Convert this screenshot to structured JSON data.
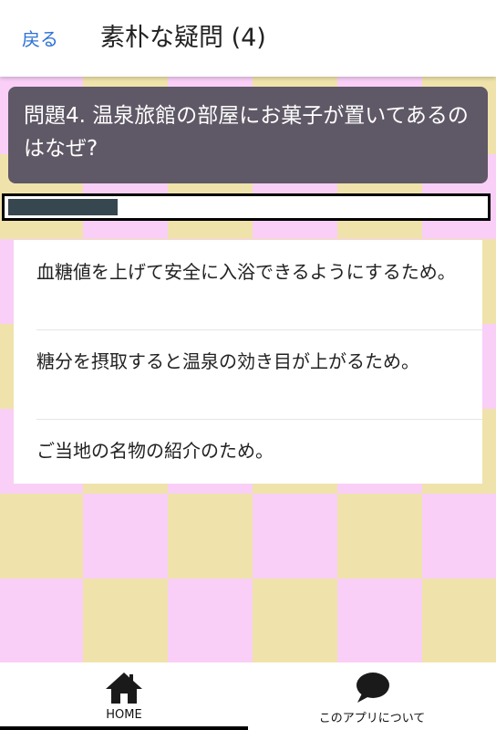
{
  "header": {
    "back_label": "戻る",
    "title": "素朴な疑問 (4)"
  },
  "question": {
    "text": "問題4. 温泉旅館の部屋にお菓子が置いてあるのはなぜ?"
  },
  "progress": {
    "fraction": 0.23
  },
  "answers": [
    {
      "text": "血糖値を上げて安全に入浴できるようにするため。"
    },
    {
      "text": "糖分を摂取すると温泉の効き目が上がるため。"
    },
    {
      "text": "ご当地の名物の紹介のため。"
    }
  ],
  "bottom_nav": {
    "items": [
      {
        "label": "HOME",
        "icon": "home-icon",
        "active": true
      },
      {
        "label": "このアプリについて",
        "icon": "chat-bubble-icon",
        "active": false
      }
    ]
  },
  "colors": {
    "accent_link": "#2f73d8",
    "checker_pink": "#f9cff7",
    "checker_beige": "#efe3ab",
    "question_bg": "#5f5866",
    "progress_fill": "#37474f"
  }
}
